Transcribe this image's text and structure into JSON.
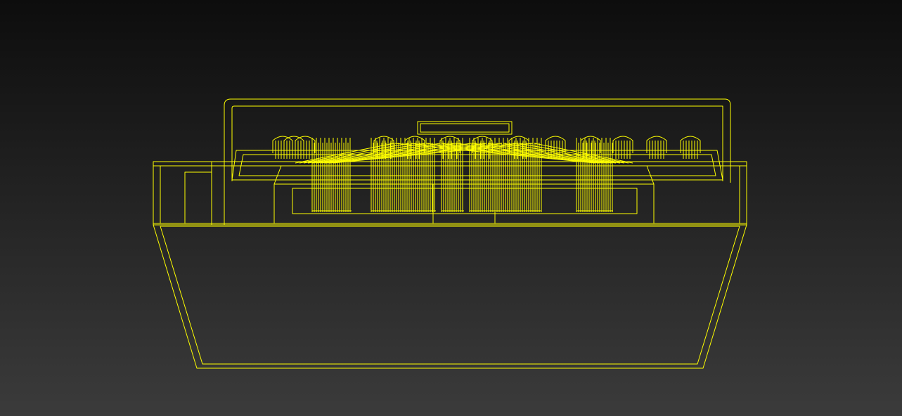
{
  "viewport": {
    "projection": "front-orthographic",
    "display_mode": "wireframe",
    "background_top": "#0d0d0d",
    "background_bottom": "#3b3b3b",
    "wire_color": "#ffff00"
  },
  "model": {
    "object": "mixer-console",
    "front_knob_rows": 9,
    "dense_knob_clusters": 3
  }
}
